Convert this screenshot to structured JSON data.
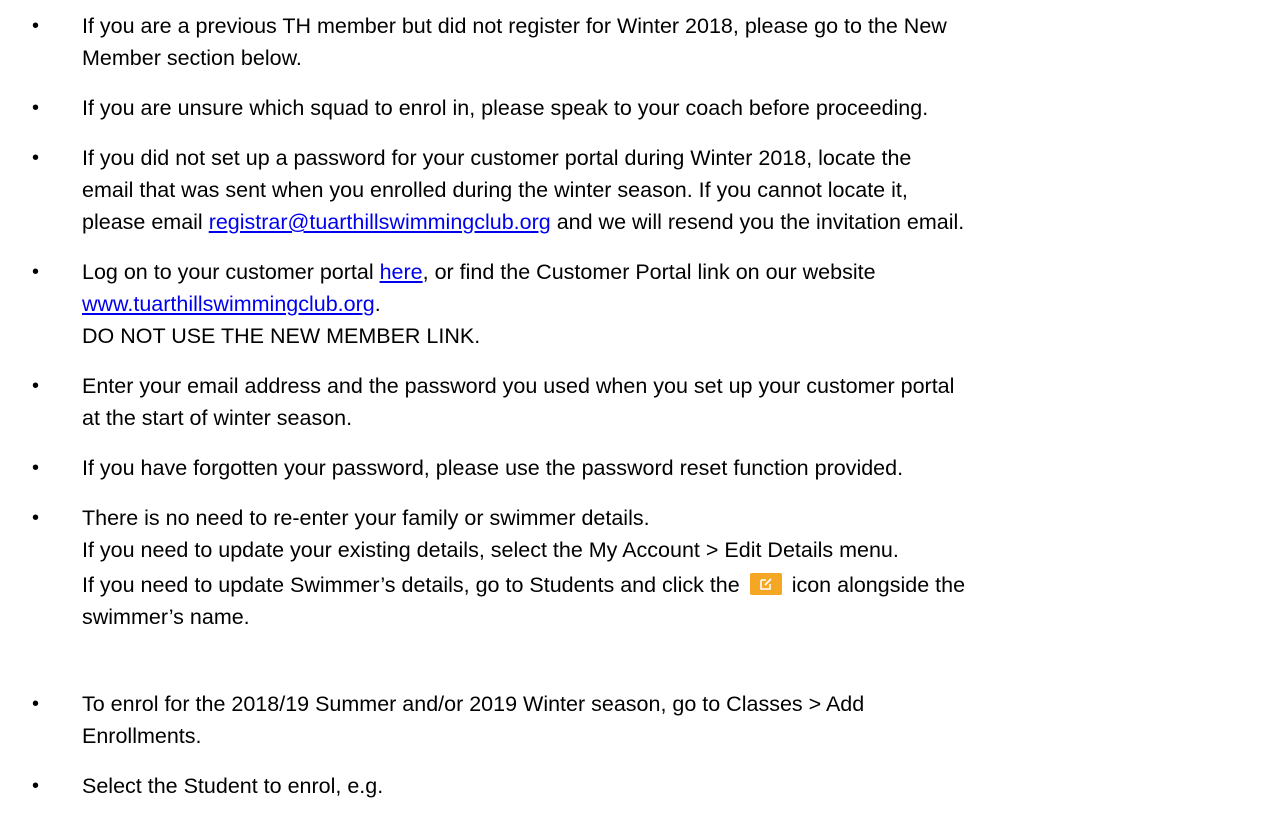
{
  "bullet_glyph": "•",
  "items": [
    {
      "lines": [
        "If you are a previous TH member but did not register for Winter 2018, please go to the New",
        "Member section below."
      ]
    },
    {
      "lines": [
        "If you are unsure which squad to enrol in, please speak to your coach before proceeding."
      ]
    },
    {
      "line1": "If you did not set up a password for your customer portal during Winter 2018, locate the",
      "line2": "email that was sent when you enrolled during the winter season. If you cannot locate it,",
      "line3_prefix": "please email ",
      "email_link": "registrar@tuarthillswimmingclub.org",
      "line3_suffix": " and we will resend you the invitation email."
    },
    {
      "line1_prefix": "Log on to your customer portal ",
      "here_link": "here",
      "line1_suffix": ", or find the Customer Portal link on our website",
      "website_link": "www.tuarthillswimmingclub.org",
      "line2_suffix": ".",
      "warning": "DO NOT USE THE NEW MEMBER LINK."
    },
    {
      "lines": [
        "Enter your email address and the password you used when you set up your customer portal",
        "at the start of winter season."
      ]
    },
    {
      "lines": [
        "If you have forgotten your password, please use the password reset function provided."
      ]
    },
    {
      "line1": "There is no need to re-enter your family or swimmer details.",
      "line2": "If you need to update your existing details, select the My Account > Edit Details menu.",
      "line3_prefix": "If you need to update Swimmer’s details, go to Students and click the",
      "edit_icon": "edit-icon",
      "line3_suffix": "icon alongside the",
      "line4": "swimmer’s name."
    },
    {
      "lines": [
        "To enrol for the 2018/19 Summer and/or 2019 Winter season, go to Classes > Add",
        "Enrollments."
      ]
    },
    {
      "lines": [
        "Select the Student to enrol, e.g."
      ]
    }
  ],
  "colors": {
    "link": "#0000ee",
    "edit_icon_bg": "#f5a623"
  }
}
